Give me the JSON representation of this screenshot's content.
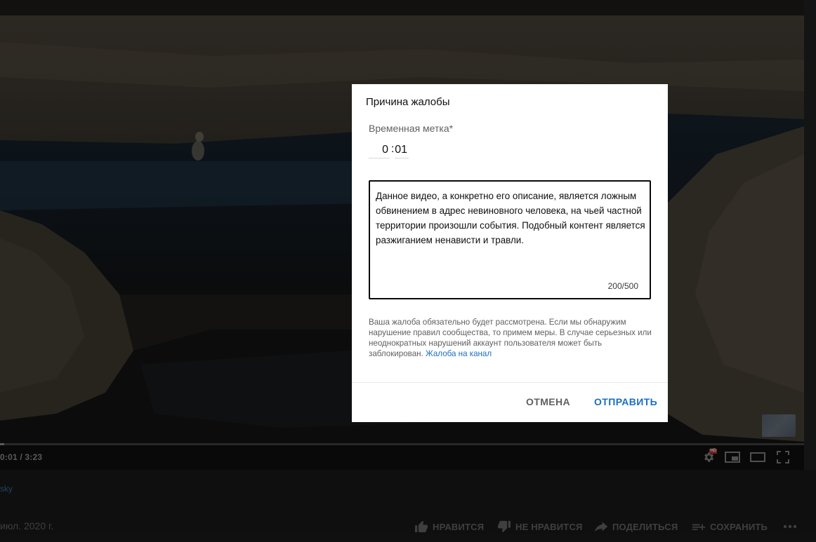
{
  "player": {
    "time_readout": "0:01 / 3:23",
    "progress_fraction": 0.005
  },
  "page": {
    "channel_text": "sky",
    "date_text": "июл. 2020 г.",
    "actions": {
      "like": "НРАВИТСЯ",
      "dislike": "НЕ НРАВИТСЯ",
      "share": "ПОДЕЛИТЬСЯ",
      "save": "СОХРАНИТЬ"
    }
  },
  "dialog": {
    "title": "Причина жалобы",
    "timestamp_label": "Временная метка*",
    "timestamp_minutes": "0",
    "timestamp_seconds": "01",
    "description": "Данное видео, а конкретно его описание, является ложным обвинением в адрес невиновного человека, на чьей частной территории произошли события. Подобный контент является разжиганием ненависти и травли.",
    "char_count": "200/500",
    "notice_text": "Ваша жалоба обязательно будет рассмотрена. Если мы обнаружим нарушение правил сообщества, то примем меры. В случае серьезных или неоднократных нарушений аккаунт пользователя может быть заблокирован.",
    "notice_link": "Жалоба на канал",
    "cancel_label": "ОТМЕНА",
    "submit_label": "ОТПРАВИТЬ"
  },
  "colors": {
    "accent": "#1a6fc2",
    "dialog_bg": "#ffffff",
    "hd_badge": "#c63a3a"
  },
  "icons": [
    "settings-icon",
    "hd-badge",
    "miniplayer-icon",
    "theater-mode-icon",
    "fullscreen-icon",
    "thumbs-up-icon",
    "thumbs-down-icon",
    "share-icon",
    "save-playlist-icon",
    "more-icon"
  ]
}
